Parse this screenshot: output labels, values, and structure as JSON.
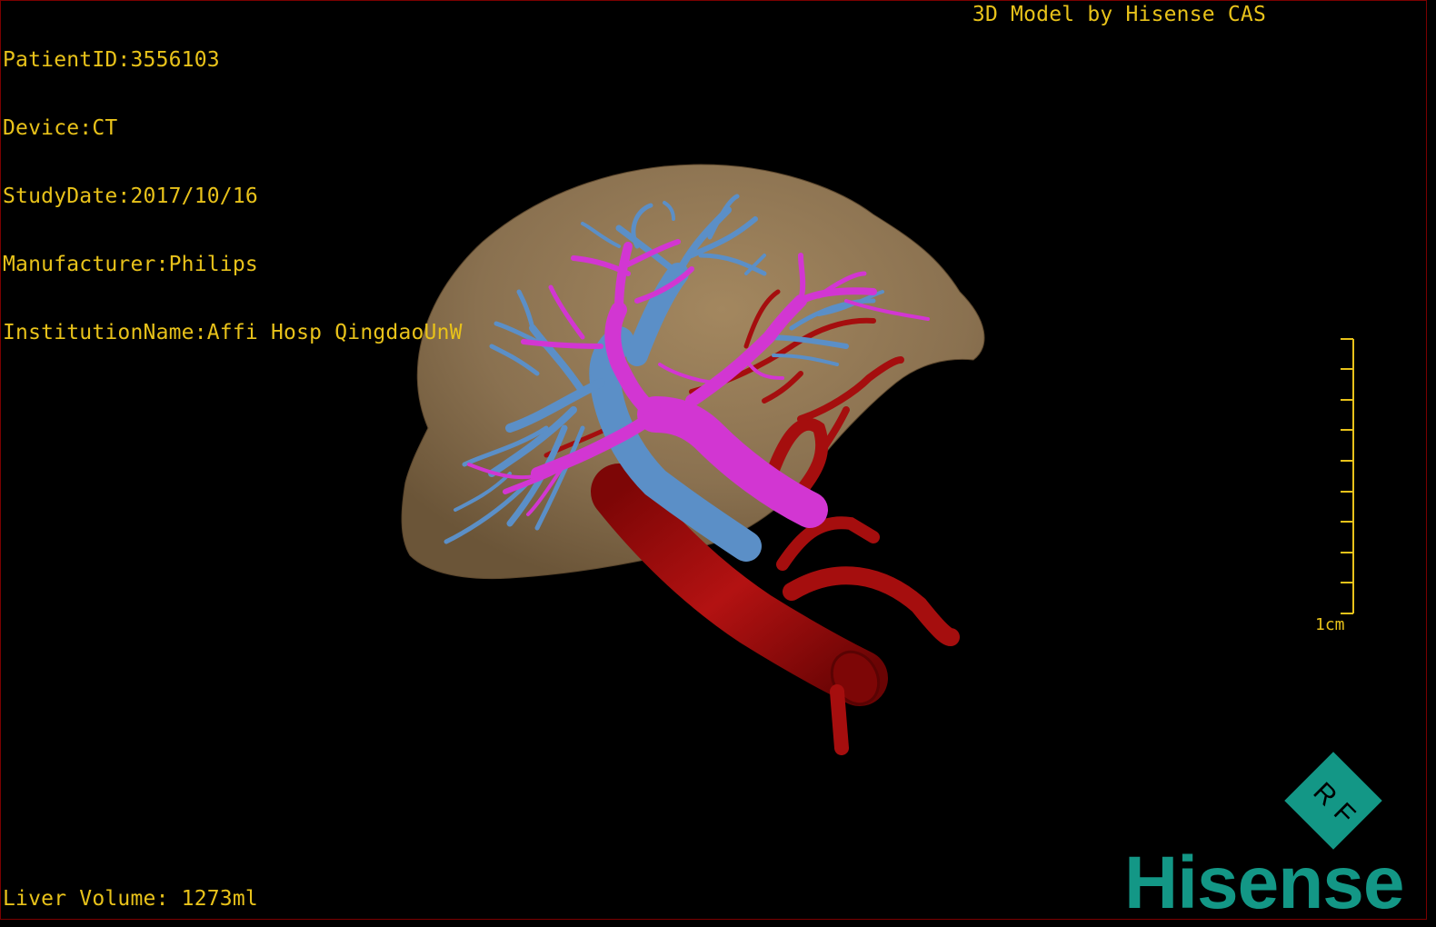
{
  "patient_info": {
    "patient_id": "PatientID:3556103",
    "device": "Device:CT",
    "study_date": "StudyDate:2017/10/16",
    "manufacturer": "Manufacturer:Philips",
    "institution": "InstitutionName:Affi Hosp QingdaoUnW"
  },
  "credit": "3D Model by Hisense CAS",
  "liver_volume": "Liver Volume: 1273ml",
  "scale_bar": {
    "label": "1cm",
    "tick_count": 10
  },
  "logo": {
    "brand": "Hisense",
    "badge": "RF"
  },
  "colors": {
    "overlay_text": "#e8c21a",
    "liver": "#8a7150",
    "hepatic_vein": "#5b8fc7",
    "portal_vein": "#d236d2",
    "artery": "#9a0c0c",
    "logo": "#139786",
    "border": "#7a0000"
  }
}
